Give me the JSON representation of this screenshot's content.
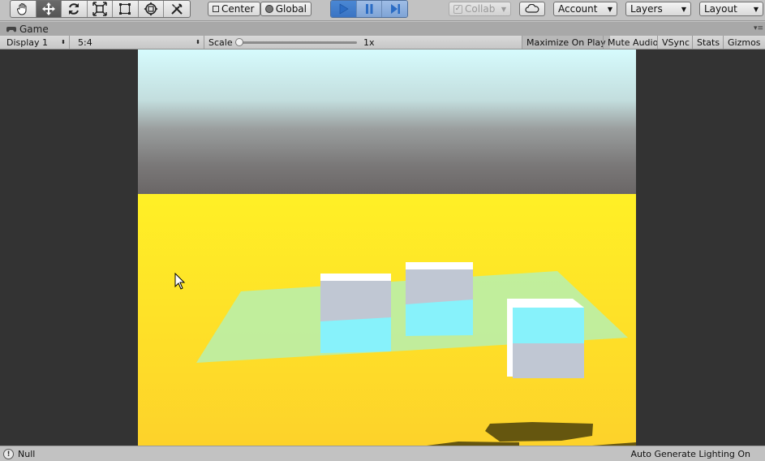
{
  "toolbar": {
    "tools": [
      {
        "name": "hand-tool",
        "icon": "hand-icon",
        "active": false
      },
      {
        "name": "move-tool",
        "icon": "move-arrows-icon",
        "active": true
      },
      {
        "name": "rotate-tool",
        "icon": "rotate-icon",
        "active": false
      },
      {
        "name": "scale-tool",
        "icon": "scale-icon",
        "active": false
      },
      {
        "name": "rect-tool",
        "icon": "rect-transform-icon",
        "active": false
      },
      {
        "name": "transform-tool",
        "icon": "transform-icon",
        "active": false
      },
      {
        "name": "custom-tool",
        "icon": "tools-icon",
        "active": false
      }
    ],
    "pivot_label": "Center",
    "space_label": "Global",
    "play_icon": "play-icon",
    "pause_icon": "pause-icon",
    "step_icon": "step-icon",
    "collab_label": "Collab",
    "cloud_icon": "cloud-icon",
    "account_label": "Account",
    "layers_label": "Layers",
    "layout_label": "Layout"
  },
  "tab": {
    "title": "Game",
    "icon": "game-controller-icon"
  },
  "controls": {
    "display": "Display 1",
    "aspect": "5:4",
    "scale_label": "Scale",
    "scale_value": "1x",
    "scale_level": 0.0,
    "maximize": "Maximize On Play",
    "mute": "Mute Audio",
    "vsync": "VSync",
    "stats": "Stats",
    "gizmos": "Gizmos"
  },
  "status": {
    "icon": "info-icon",
    "message": "Null",
    "lighting": "Auto Generate Lighting On"
  },
  "colors": {
    "sky_top": "#d6fbfd",
    "sky_bottom": "#6a6666",
    "ground": "#fdd22a",
    "plane": "#b6f0b0",
    "cube_top": "#ffffff",
    "cube_side": "#c0c7d3",
    "cube_water": "#87f2fb",
    "play_active": "#3f7ccb"
  }
}
